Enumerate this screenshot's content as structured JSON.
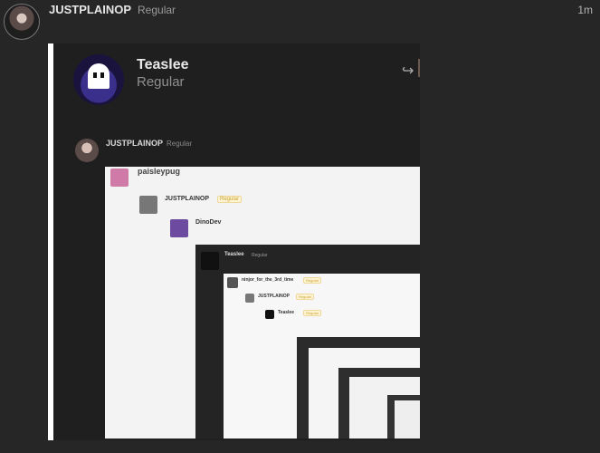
{
  "post": {
    "username": "JUSTPLAINOP",
    "user_tag": "Regular",
    "timestamp": "1m"
  },
  "quote": {
    "username": "Teaslee",
    "user_tag": "Regular",
    "inner_post": {
      "username": "JUSTPLAINOP",
      "user_tag": "Regular",
      "screenshot": {
        "users": [
          {
            "name": "paisleypug"
          },
          {
            "name": "JUSTPLAINOP",
            "tag": "Regular"
          },
          {
            "name": "DinoDev"
          },
          {
            "name": "Teaslee",
            "tag": "Regular"
          },
          {
            "name": "ninjor_for_the_3rd_time",
            "tag": "Regular"
          },
          {
            "name": "JUSTPLAINOP",
            "tag": "Regular"
          },
          {
            "name": "Teaslee",
            "tag": "Regular"
          }
        ]
      }
    }
  },
  "icons": {
    "share": "share-icon",
    "ghost_avatar": "ghost-avatar"
  },
  "colors": {
    "background": "#262626",
    "quote_border": "#ffffff",
    "accent": "#c0392b",
    "tag_badge": "#c9a332"
  }
}
